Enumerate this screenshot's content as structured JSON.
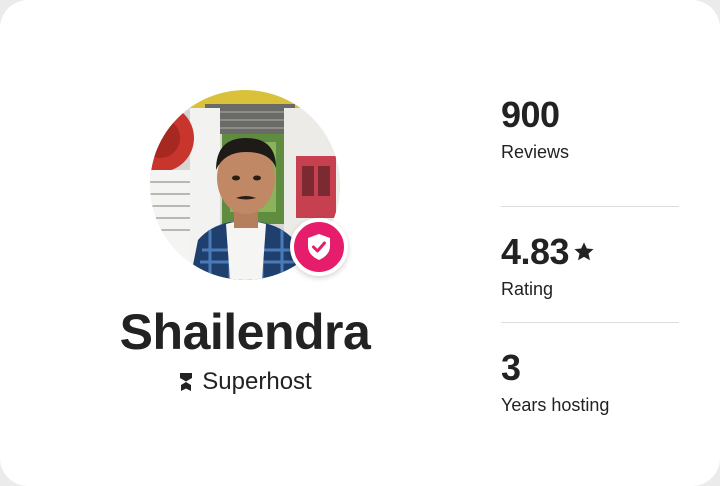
{
  "host": {
    "name": "Shailendra",
    "badge_label": "Superhost"
  },
  "stats": [
    {
      "value": "900",
      "label": "Reviews"
    },
    {
      "value": "4.83",
      "label": "Rating",
      "icon": "star-icon"
    },
    {
      "value": "3",
      "label": "Years hosting"
    }
  ],
  "colors": {
    "verified_badge": "#e51d6b",
    "text": "#222222",
    "divider": "#dddddd"
  },
  "icons": {
    "verified": "shield-check-icon",
    "superhost": "superhost-medal-icon",
    "rating": "star-icon"
  }
}
